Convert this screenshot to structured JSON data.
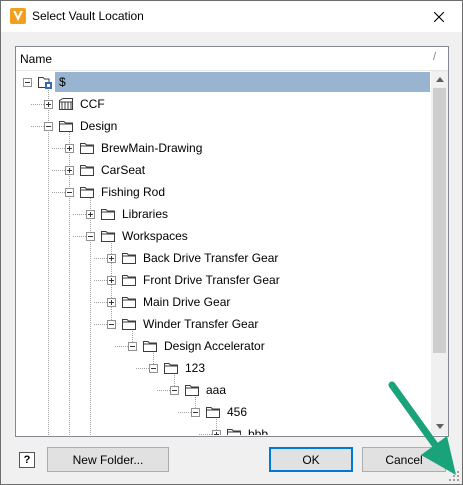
{
  "window": {
    "title": "Select Vault Location",
    "accent": "#0078d7",
    "app_icon_color": "#f0a01e"
  },
  "tree": {
    "column_name": "Name",
    "column_sep": "/",
    "nodes": [
      {
        "label": "$",
        "depth": 0,
        "expander": "minus",
        "icon": "vault-root-icon",
        "selected": true
      },
      {
        "label": "CCF",
        "depth": 1,
        "expander": "plus",
        "icon": "library-folder-icon",
        "selected": false
      },
      {
        "label": "Design",
        "depth": 1,
        "expander": "minus",
        "icon": "folder-icon",
        "selected": false
      },
      {
        "label": "BrewMain-Drawing",
        "depth": 2,
        "expander": "plus",
        "icon": "folder-icon",
        "selected": false
      },
      {
        "label": "CarSeat",
        "depth": 2,
        "expander": "plus",
        "icon": "folder-icon",
        "selected": false
      },
      {
        "label": "Fishing Rod",
        "depth": 2,
        "expander": "minus",
        "icon": "folder-icon",
        "selected": false
      },
      {
        "label": "Libraries",
        "depth": 3,
        "expander": "plus",
        "icon": "folder-icon",
        "selected": false
      },
      {
        "label": "Workspaces",
        "depth": 3,
        "expander": "minus",
        "icon": "folder-icon",
        "selected": false
      },
      {
        "label": "Back Drive Transfer Gear",
        "depth": 4,
        "expander": "plus",
        "icon": "folder-icon",
        "selected": false
      },
      {
        "label": "Front Drive Transfer Gear",
        "depth": 4,
        "expander": "plus",
        "icon": "folder-icon",
        "selected": false
      },
      {
        "label": "Main Drive Gear",
        "depth": 4,
        "expander": "plus",
        "icon": "folder-icon",
        "selected": false
      },
      {
        "label": "Winder Transfer Gear",
        "depth": 4,
        "expander": "minus",
        "icon": "folder-icon",
        "selected": false
      },
      {
        "label": "Design Accelerator",
        "depth": 5,
        "expander": "minus",
        "icon": "folder-icon",
        "selected": false
      },
      {
        "label": "123",
        "depth": 6,
        "expander": "minus",
        "icon": "folder-icon",
        "selected": false
      },
      {
        "label": "aaa",
        "depth": 7,
        "expander": "minus",
        "icon": "folder-icon",
        "selected": false
      },
      {
        "label": "456",
        "depth": 8,
        "expander": "minus",
        "icon": "folder-icon",
        "selected": false
      },
      {
        "label": "bbb",
        "depth": 9,
        "expander": "plus",
        "icon": "folder-icon",
        "selected": false
      }
    ]
  },
  "buttons": {
    "help": "?",
    "new_folder": "New Folder...",
    "ok": "OK",
    "cancel": "Cancel"
  },
  "annotation": {
    "arrow_color": "#1aa37a",
    "icon": "arrow-pointing-to-resize-grip-icon"
  }
}
